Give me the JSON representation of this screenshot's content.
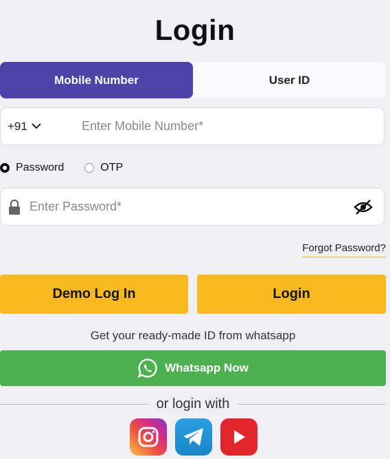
{
  "page": {
    "title": "Login"
  },
  "tabs": [
    {
      "label": "Mobile Number",
      "active": true
    },
    {
      "label": "User ID",
      "active": false
    }
  ],
  "mobile": {
    "country_code": "+91",
    "placeholder": "Enter Mobile Number*",
    "value": ""
  },
  "auth_mode": {
    "options": [
      {
        "label": "Password",
        "selected": true
      },
      {
        "label": "OTP",
        "selected": false
      }
    ]
  },
  "password": {
    "placeholder": "Enter Password*",
    "value": ""
  },
  "forgot_password": "Forgot Password?",
  "buttons": {
    "demo": "Demo Log In",
    "login": "Login"
  },
  "whatsapp": {
    "promo": "Get your ready-made ID from whatsapp",
    "button": "Whatsapp Now"
  },
  "divider": "or login with",
  "social": [
    {
      "icon": "instagram-icon"
    },
    {
      "icon": "telegram-icon"
    },
    {
      "icon": "youtube-icon"
    }
  ],
  "colors": {
    "accent": "#4c43a8",
    "button": "#f8b91f",
    "whatsapp": "#4caf50"
  }
}
